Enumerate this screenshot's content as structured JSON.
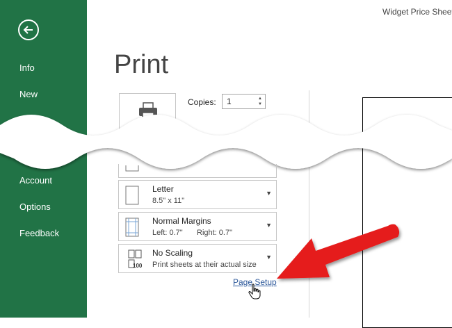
{
  "window": {
    "title": "Widget Price Sheet"
  },
  "sidebar": {
    "back_label": "Back",
    "items": [
      {
        "label": "Info"
      },
      {
        "label": "New"
      },
      {
        "label": "Account"
      },
      {
        "label": "Options"
      },
      {
        "label": "Feedback"
      }
    ]
  },
  "print": {
    "title": "Print",
    "copies_label": "Copies:",
    "copies_value": "1"
  },
  "settings": {
    "paper": {
      "main": "Letter",
      "sub": "8.5\" x 11\""
    },
    "margins": {
      "main": "Normal Margins",
      "left": "Left: 0.7\"",
      "right": "Right: 0.7\""
    },
    "scaling": {
      "main": "No Scaling",
      "sub": "Print sheets at their actual size",
      "icon_text": "100"
    }
  },
  "link": {
    "page_setup": "Page Setup"
  },
  "colors": {
    "sidebar": "#217346",
    "annotation_arrow": "#e51c1c",
    "link": "#2b579a"
  }
}
